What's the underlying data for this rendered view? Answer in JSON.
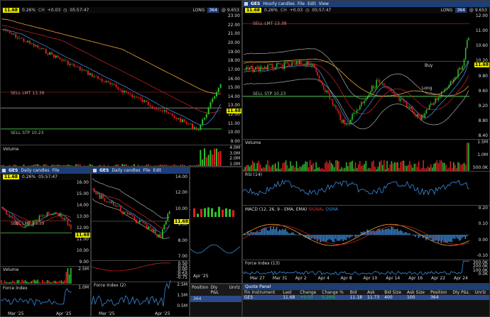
{
  "main": {
    "title": "GES",
    "price": "11.68",
    "chg_pct": "0.26%",
    "chg_label": "CH",
    "chg": "+0.03",
    "time": "05:57:47",
    "pos_label": "LONG",
    "pos_qty": "364",
    "avg": "@ 9.653",
    "axis": [
      "23.00",
      "22.00",
      "21.00",
      "20.00",
      "19.00",
      "18.00",
      "17.00",
      "16.00",
      "15.00",
      "14.00",
      "13.00",
      "12.00",
      "11.00",
      "10.00",
      "9.00"
    ],
    "sell_lmt": "SELL LMT 13.39",
    "sell_stp": "SELL STP 10.23",
    "volume_label": "Volume",
    "vol_axis": [
      "4.0M",
      "3.0M",
      "2.0M",
      "1.0M"
    ]
  },
  "hourly": {
    "title": "GES",
    "menu_candles": "Hourly candles",
    "menu_file": "File",
    "menu_edit": "Edit",
    "menu_view": "View",
    "price": "11.68",
    "chg_pct": "0.26%",
    "chg_label": "CH",
    "chg": "+0.03",
    "time": "05:57:47",
    "pos_label": "LONG",
    "pos_qty": "364",
    "avg": "@ 9.653",
    "axis": [
      "12.00",
      "11.00",
      "10.60",
      "10.20",
      "9.80",
      "9.60",
      "9.20",
      "8.80",
      "8.40"
    ],
    "sell_lmt": "SELL LMT 13.38",
    "sell_stp": "SELL STP 10.23",
    "volume_label": "Volume",
    "vol_axis": [
      "1.5M",
      "1.0M",
      "500.0K"
    ],
    "rsi_label": "RSI",
    "rsi_param": "(14)",
    "macd_label": "MACD",
    "macd_param": "(12, 26, 9 - EMA, EMA)",
    "macd_signal": "SIGNAL",
    "macd_osma": "OSMA",
    "macd_axis": [
      "0.20",
      "0.10",
      "0.00",
      "-0.10"
    ],
    "fi_label": "Force Index",
    "fi_param": "(13)",
    "fi_axis": [
      "300.0K",
      "200.0K",
      "100.0K",
      "0.0K"
    ],
    "dates": [
      "Mar 27",
      "Mar 31",
      "Apr 2",
      "Apr 4",
      "Apr 8",
      "Apr 10",
      "Apr 14",
      "Apr 16",
      "Apr 22",
      "Apr 24"
    ],
    "note_buy": "Buy",
    "note_long": "Long"
  },
  "small1": {
    "title": "GES",
    "menu_candles": "Daily candles",
    "menu_file": "File",
    "price": "11.68",
    "chg_pct": "0.26%",
    "time": "05:57:47",
    "sell_lmt": "SELL LMT 13.39",
    "axis": [
      "16.00",
      "15.00",
      "14.00",
      "13.00",
      "12.00",
      "11.00",
      "10.00",
      "9.00"
    ],
    "tag": "11.68",
    "volume_label": "Volume",
    "vol_axis": [
      "2.5M"
    ],
    "fi_label": "Force Index",
    "fi_axis": [
      "1.0M"
    ],
    "dates": [
      "Mar '25",
      "Apr '25"
    ]
  },
  "small2": {
    "title": "GES",
    "menu_candles": "Daily candles",
    "menu_file": "File",
    "menu_edit": "Edit",
    "axis": [
      "14.00",
      "12.00",
      "10.00",
      "9.00",
      "8.00",
      "7.00"
    ],
    "tag": "11.68",
    "macd_axis": [
      "0.50",
      "0.25",
      "0.00",
      "-0.25",
      "-0.50",
      "-0.75"
    ],
    "fi_label": "Force Index",
    "fi_param": "(2)",
    "fi_axis": [
      "2.5M",
      "1.5M",
      "0.5M"
    ],
    "dates": [
      "Mar '25",
      "Apr '25"
    ]
  },
  "bottom_left_mini": {
    "date": "Apr '25",
    "cols": [
      "Position",
      "Dly P&L",
      "Unrlz"
    ],
    "row": [
      "364",
      ""
    ]
  },
  "quote_panel": {
    "title": "Quote Panel",
    "headers": [
      "Fin Instrument",
      "Last",
      "Change",
      "Change %",
      "Bid",
      "Ask",
      "Bid Size",
      "Ask Size",
      "Position",
      "Dly P&L",
      "Unrlz"
    ],
    "row": [
      "GES",
      "11.68",
      "+0.03",
      "0.26%",
      "11.18",
      "11.73",
      "400",
      "100",
      "364",
      "",
      ""
    ]
  },
  "colors": {
    "up": "#2ec02e",
    "down": "#e02020",
    "ma_orange": "#f0a030",
    "ma_red": "#c02020",
    "ma_blue": "#3a8ad8",
    "title_bg": "#1c3f7a",
    "highlight": "#e8e800"
  }
}
